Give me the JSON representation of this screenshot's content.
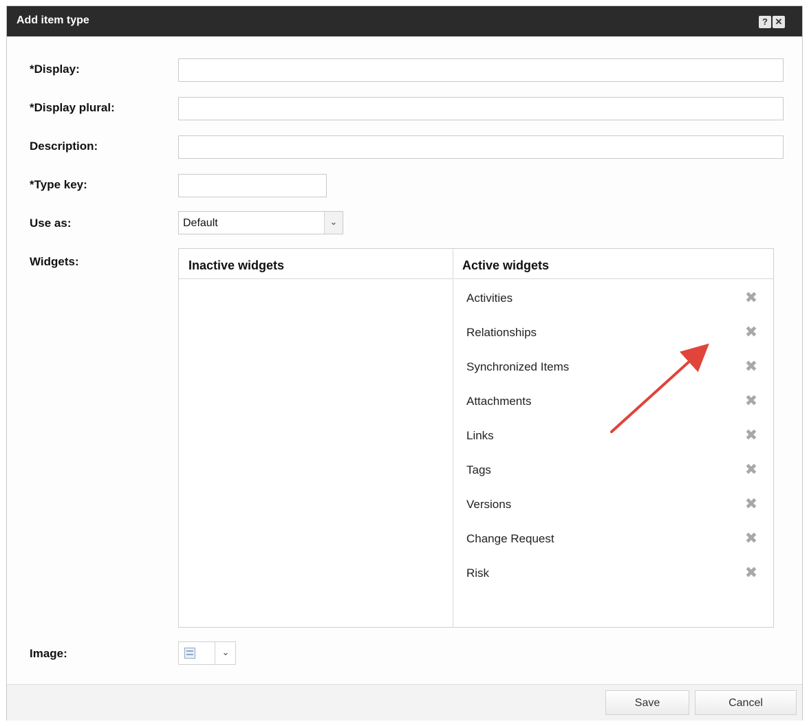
{
  "dialog": {
    "title": "Add item type",
    "help_icon": "question-icon",
    "close_icon": "close-icon"
  },
  "form": {
    "display_label": "*Display:",
    "display_value": "",
    "display_plural_label": "*Display plural:",
    "display_plural_value": "",
    "description_label": "Description:",
    "description_value": "",
    "type_key_label": "*Type key:",
    "type_key_value": "",
    "use_as_label": "Use as:",
    "use_as_value": "Default",
    "widgets_label": "Widgets:",
    "image_label": "Image:"
  },
  "widgets": {
    "inactive_header": "Inactive widgets",
    "active_header": "Active widgets",
    "inactive": [],
    "active": [
      "Activities",
      "Relationships",
      "Synchronized Items",
      "Attachments",
      "Links",
      "Tags",
      "Versions",
      "Change Request",
      "Risk"
    ]
  },
  "footer": {
    "save_label": "Save",
    "cancel_label": "Cancel"
  },
  "colors": {
    "titlebar": "#2b2b2b",
    "annotation_arrow": "#e0443a"
  }
}
